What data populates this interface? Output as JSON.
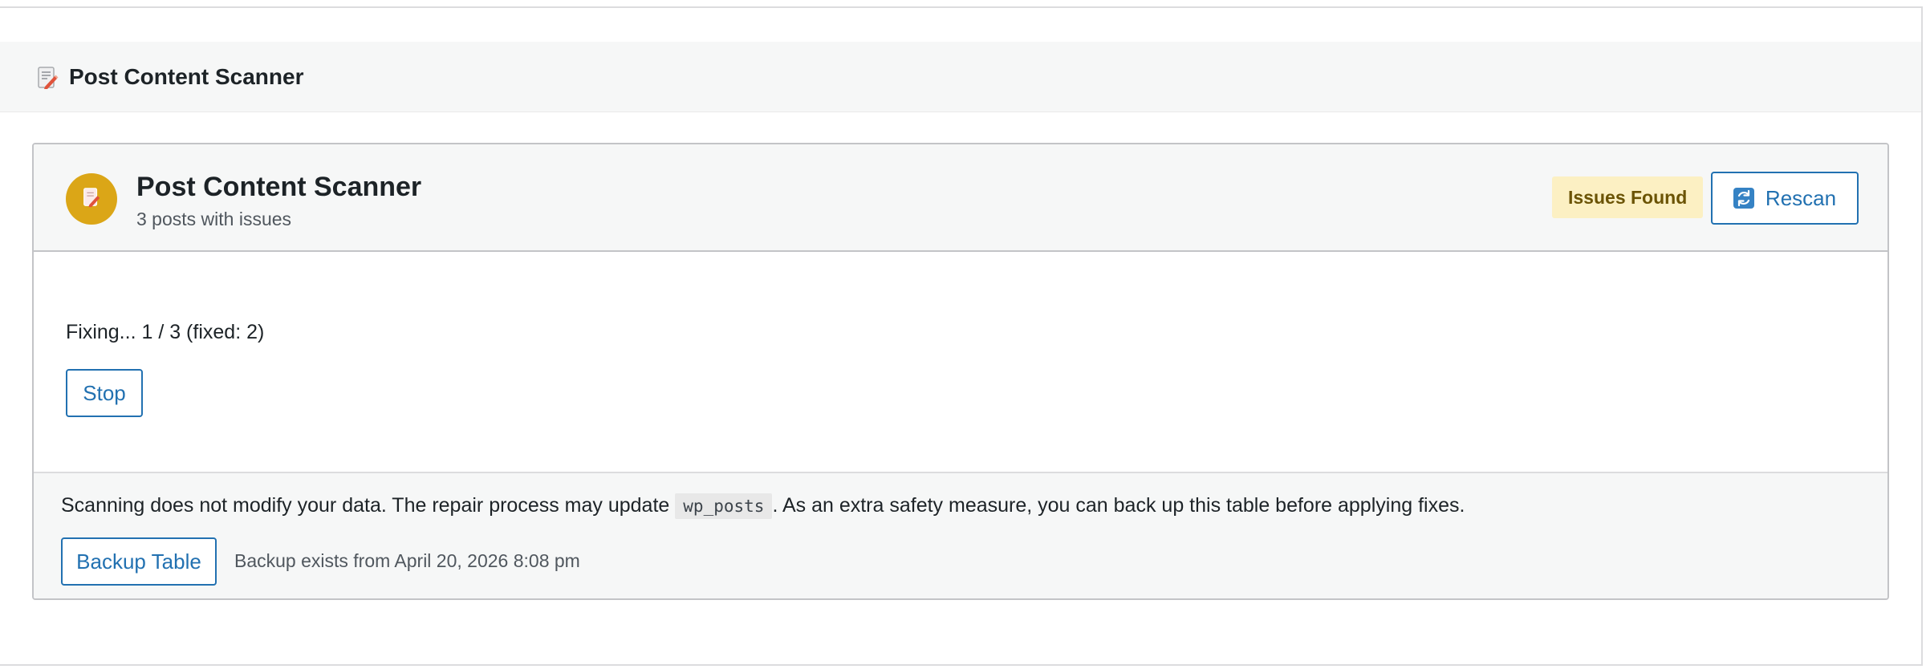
{
  "page_header": {
    "title": "Post Content Scanner",
    "icon": "memo-icon"
  },
  "card": {
    "title": "Post Content Scanner",
    "subtitle": "3 posts with issues",
    "avatar_icon": "memo-icon",
    "status_badge": "Issues Found",
    "rescan_label": "Rescan",
    "rescan_icon": "refresh-icon"
  },
  "progress": {
    "text": "Fixing... 1 / 3 (fixed: 2)",
    "stop_label": "Stop"
  },
  "notice": {
    "text_before": "Scanning does not modify your data. The repair process may update",
    "table_name": "wp_posts",
    "text_after": ". As an extra safety measure, you can back up this table before applying fixes.",
    "backup_label": "Backup Table",
    "backup_status": "Backup exists from April 20, 2026 8:08 pm"
  },
  "colors": {
    "accent": "#2271b1",
    "avatar": "#dba617",
    "badge_bg": "#fcf0c3",
    "badge_text": "#6b5304"
  }
}
